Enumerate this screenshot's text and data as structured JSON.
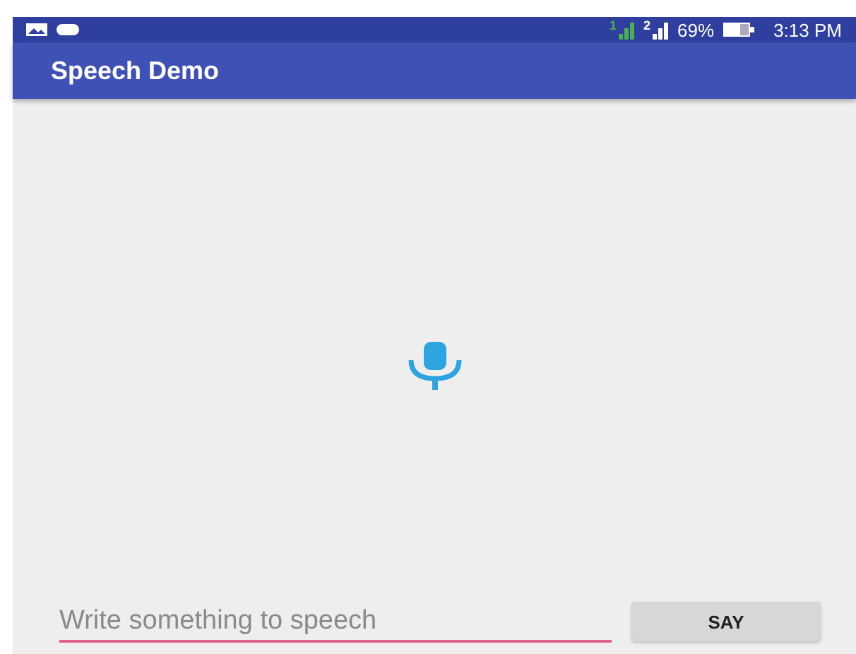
{
  "status_bar": {
    "sims": [
      {
        "label": "1",
        "color": "#4caf50"
      },
      {
        "label": "2",
        "color": "#ffffff"
      }
    ],
    "battery": "69%",
    "time": "3:13 PM"
  },
  "app_bar": {
    "title": "Speech Demo"
  },
  "input": {
    "placeholder": "Write something to speech"
  },
  "button": {
    "label": "SAY"
  }
}
